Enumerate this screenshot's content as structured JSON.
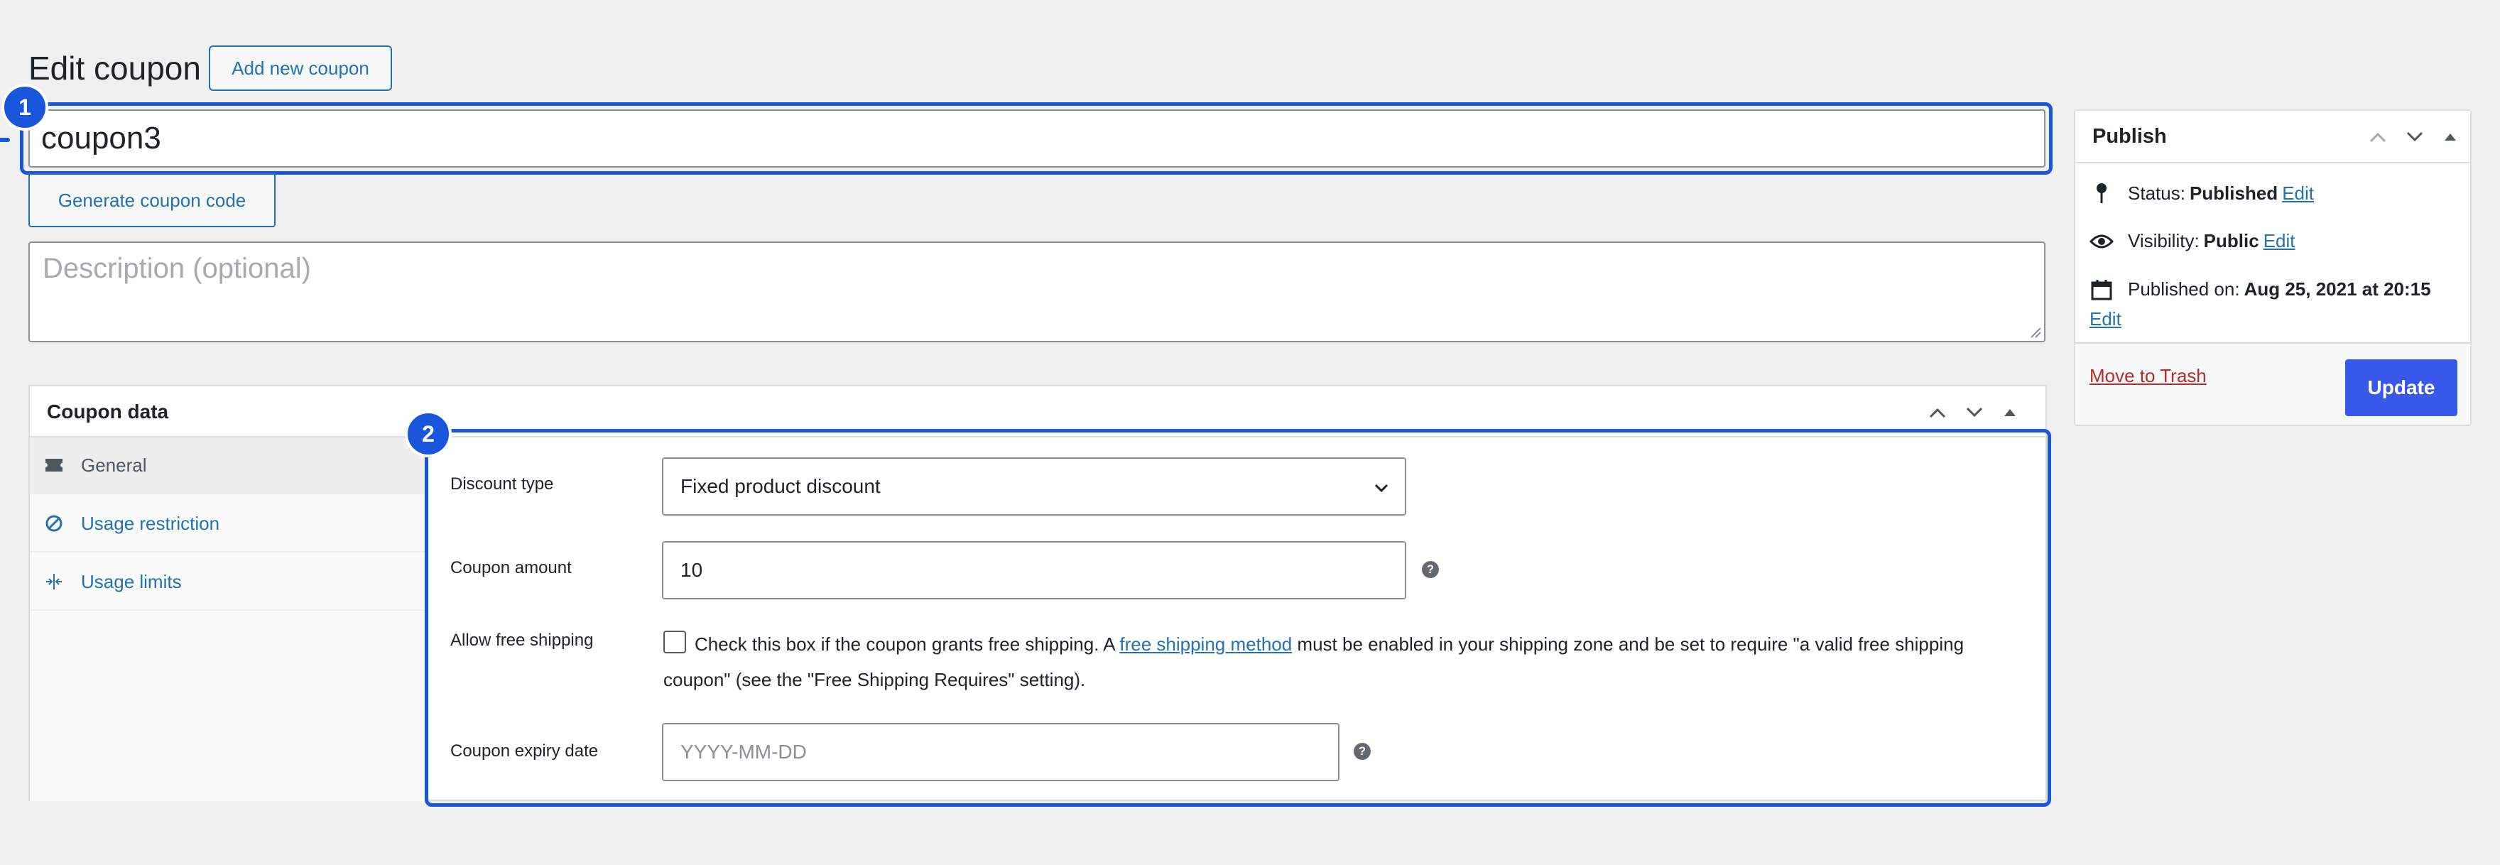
{
  "header": {
    "title": "Edit coupon",
    "add_new_label": "Add new coupon"
  },
  "coupon": {
    "code": "coupon3",
    "generate_label": "Generate coupon code",
    "description_placeholder": "Description (optional)"
  },
  "callouts": [
    "1",
    "2"
  ],
  "coupon_data": {
    "title": "Coupon data",
    "tabs": [
      {
        "label": "General",
        "icon": "ticket-icon",
        "active": true
      },
      {
        "label": "Usage restriction",
        "icon": "block-icon",
        "active": false
      },
      {
        "label": "Usage limits",
        "icon": "limits-icon",
        "active": false
      }
    ],
    "general": {
      "discount_type_label": "Discount type",
      "discount_type_value": "Fixed product discount",
      "amount_label": "Coupon amount",
      "amount_value": "10",
      "free_shipping_label": "Allow free shipping",
      "free_shipping_text_before": "Check this box if the coupon grants free shipping. A ",
      "free_shipping_link": "free shipping method",
      "free_shipping_text_after": " must be enabled in your shipping zone and be set to require \"a valid free shipping coupon\" (see the \"Free Shipping Requires\" setting).",
      "expiry_label": "Coupon expiry date",
      "expiry_placeholder": "YYYY-MM-DD",
      "help_glyph": "?"
    }
  },
  "publish": {
    "title": "Publish",
    "status_label": "Status:",
    "status_value": "Published",
    "visibility_label": "Visibility:",
    "visibility_value": "Public",
    "published_label": "Published on:",
    "published_value": "Aug 25, 2021 at 20:15",
    "edit_label": "Edit",
    "trash_label": "Move to Trash",
    "update_label": "Update"
  },
  "colors": {
    "accent": "#2271b1",
    "highlight": "#1a56db",
    "primary_button": "#3858e9",
    "danger": "#b32d2e"
  }
}
